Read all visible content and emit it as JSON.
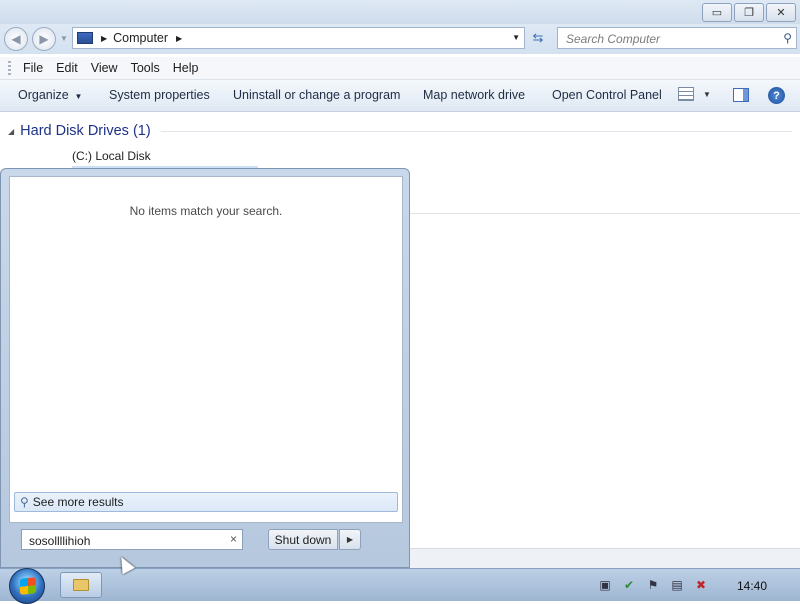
{
  "window": {
    "minimize_glyph": "▭",
    "restore_glyph": "❐",
    "close_glyph": "✕"
  },
  "address": {
    "breadcrumb": "Computer",
    "search_placeholder": "Search Computer"
  },
  "menubar": {
    "items": [
      "File",
      "Edit",
      "View",
      "Tools",
      "Help"
    ]
  },
  "commandbar": {
    "organize": "Organize",
    "system_properties": "System properties",
    "uninstall": "Uninstall or change a program",
    "map_drive": "Map network drive",
    "control_panel": "Open Control Panel",
    "help": "?"
  },
  "content": {
    "group_title": "Hard Disk Drives (1)",
    "drive_label": "(C:) Local Disk"
  },
  "startmenu": {
    "no_items": "No items match your search.",
    "see_more": "See more results",
    "search_value": "sosollllihioh",
    "clear_glyph": "×",
    "shutdown_label": "Shut down"
  },
  "taskbar": {
    "clock": "14:40"
  },
  "icons": {
    "computer": "computer-icon",
    "search": "search-icon",
    "refresh": "refresh-icon",
    "views": "views-icon",
    "preview_pane": "preview-pane-icon",
    "help": "help-icon",
    "start": "windows-start-icon",
    "explorer": "folder-icon",
    "tray": [
      "action-center-icon",
      "security-icon",
      "flag-icon",
      "network-icon",
      "volume-muted-icon"
    ]
  },
  "colors": {
    "group_title": "#1e3287",
    "taskbar": "#9fb6d2",
    "startmenu_frame": "#b6c8de"
  }
}
